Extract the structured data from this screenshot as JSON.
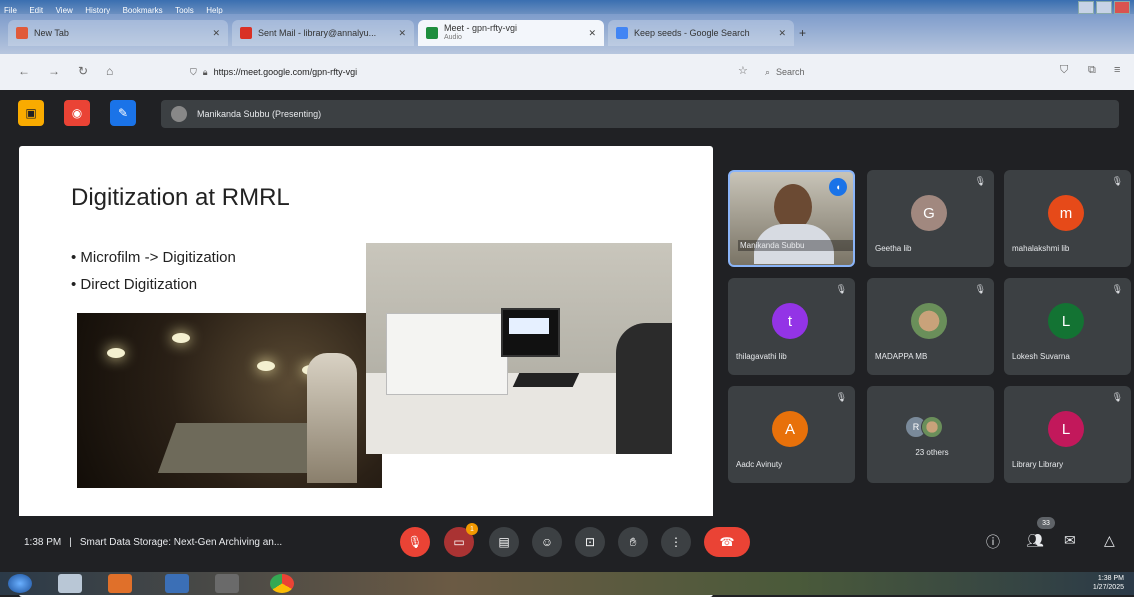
{
  "browser": {
    "menu": [
      "File",
      "Edit",
      "View",
      "History",
      "Bookmarks",
      "Tools",
      "Help"
    ],
    "tabs": [
      {
        "label": "New Tab",
        "icon_color": "#e05a3a"
      },
      {
        "label": "Sent Mail - library@annalyu...",
        "icon_color": "#d93025"
      },
      {
        "label": "Meet - gpn-rfty-vgi",
        "sublabel": "Audio",
        "icon_color": "#1e8e3e"
      },
      {
        "label": "Keep seeds - Google Search",
        "icon_color": "#4285f4"
      }
    ],
    "url": "https://meet.google.com/gpn-rfty-vgi",
    "search_placeholder": "Search"
  },
  "meet": {
    "presenter_label": "Manikanda Subbu (Presenting)",
    "slide": {
      "title": "Digitization at RMRL",
      "bullets": [
        "• Microfilm -> Digitization",
        "• Direct Digitization"
      ]
    },
    "participants": [
      {
        "name": "Manikanda Subbu",
        "speaking": true
      },
      {
        "name": "Geetha lib",
        "initial": "G",
        "color": "#a1887f"
      },
      {
        "name": "mahalakshmi lib",
        "initial": "m",
        "color": "#e64a19"
      },
      {
        "name": "thilagavathi lib",
        "initial": "t",
        "color": "#9334e6"
      },
      {
        "name": "MADAPPA MB",
        "avatar": "photo"
      },
      {
        "name": "Lokesh Suvarna",
        "initial": "L",
        "color": "#137333"
      },
      {
        "name": "Aadc Avinuty",
        "initial": "A",
        "color": "#e8710a"
      },
      {
        "name": "23 others",
        "initial": "R"
      },
      {
        "name": "Library Library",
        "initial": "L",
        "color": "#c2185b"
      }
    ],
    "time": "1:38 PM",
    "meeting_title": "Smart Data Storage: Next-Gen Archiving an...",
    "people_count": "33",
    "chat_badge": "1"
  },
  "taskbar": {
    "clock_time": "1:38 PM",
    "clock_date": "1/27/2025"
  }
}
